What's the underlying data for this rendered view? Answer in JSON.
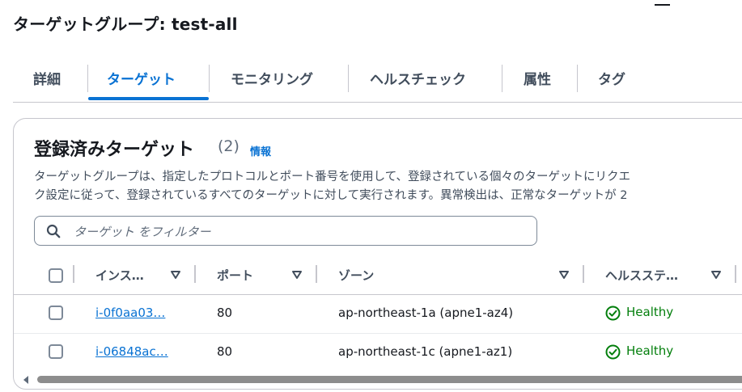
{
  "page_title": "ターゲットグループ: test-all",
  "tabs": [
    {
      "label": "詳細"
    },
    {
      "label": "ターゲット"
    },
    {
      "label": "モニタリング"
    },
    {
      "label": "ヘルスチェック"
    },
    {
      "label": "属性"
    },
    {
      "label": "タグ"
    }
  ],
  "active_tab": "ターゲット",
  "panel": {
    "title": "登録済みターゲット",
    "count": "(2)",
    "info_link": "情報",
    "description_line1": "ターゲットグループは、指定したプロトコルとポート番号を使用して、登録されている個々のターゲットにリクエ",
    "description_line2": "ク設定に従って、登録されているすべてのターゲットに対して実行されます。異常検出は、正常なターゲットが 2"
  },
  "search": {
    "placeholder": "ターゲット をフィルター",
    "value": ""
  },
  "table": {
    "columns": [
      {
        "label": "インス…"
      },
      {
        "label": "ポート"
      },
      {
        "label": "ゾーン"
      },
      {
        "label": "ヘルスステ…"
      }
    ],
    "rows": [
      {
        "instance": "i-0f0aa03…",
        "port": "80",
        "zone": "ap-northeast-1a (apne1-az4)",
        "health": "Healthy"
      },
      {
        "instance": "i-06848ac…",
        "port": "80",
        "zone": "ap-northeast-1c (apne1-az1)",
        "health": "Healthy"
      }
    ]
  },
  "icons": {
    "search": "search-icon",
    "sort": "sort-down-icon",
    "status": "check-circle-icon",
    "scroll_left": "caret-left-icon"
  },
  "colors": {
    "accent": "#0972d3",
    "healthy": "#037f0c",
    "text": "#16191f",
    "border": "#c6c6cd"
  }
}
